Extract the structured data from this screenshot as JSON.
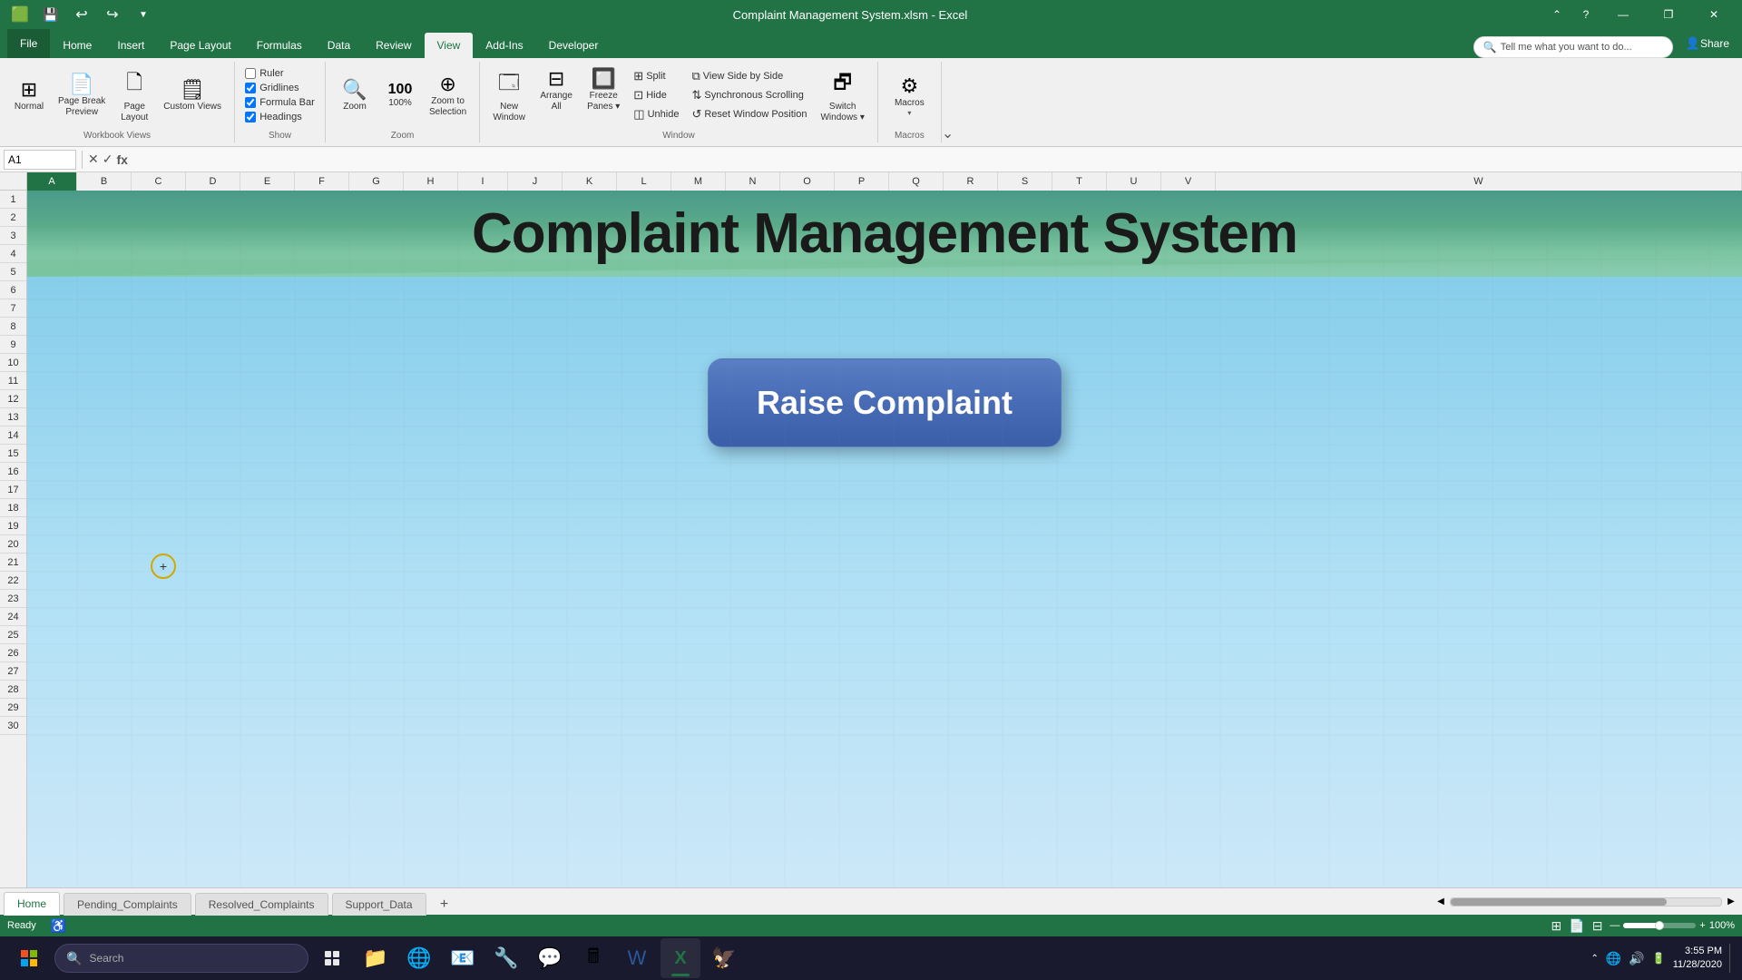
{
  "titlebar": {
    "title": "Complaint Management System.xlsm - Excel",
    "quickaccess": [
      "save",
      "undo",
      "redo",
      "customize"
    ],
    "window_controls": [
      "minimize",
      "restore",
      "close"
    ]
  },
  "ribbon": {
    "active_tab": "View",
    "tabs": [
      "File",
      "Home",
      "Insert",
      "Page Layout",
      "Formulas",
      "Data",
      "Review",
      "View",
      "Add-Ins",
      "Developer"
    ],
    "tell_me": "Tell me what you want to do...",
    "share": "Share",
    "groups": {
      "workbook_views": {
        "label": "Workbook Views",
        "normal_label": "Normal",
        "page_break_label": "Page Break\nPreview",
        "page_layout_label": "Page\nLayout",
        "custom_views_label": "Custom\nViews"
      },
      "show": {
        "label": "Show",
        "ruler_label": "Ruler",
        "gridlines_label": "Gridlines",
        "formula_bar_label": "Formula Bar",
        "headings_label": "Headings"
      },
      "zoom": {
        "label": "Zoom",
        "zoom_label": "Zoom",
        "zoom_100_label": "100%",
        "zoom_selection_label": "Zoom to\nSelection"
      },
      "window": {
        "label": "Window",
        "new_window_label": "New\nWindow",
        "arrange_all_label": "Arrange\nAll",
        "freeze_panes_label": "Freeze\nPanes",
        "split_label": "Split",
        "hide_label": "Hide",
        "unhide_label": "Unhide",
        "view_side_by_side_label": "View Side by Side",
        "synchronous_scrolling_label": "Synchronous Scrolling",
        "reset_window_label": "Reset Window Position",
        "switch_windows_label": "Switch\nWindows"
      },
      "macros": {
        "label": "Macros",
        "macros_label": "Macros"
      }
    }
  },
  "formula_bar": {
    "cell_ref": "A1",
    "formula": ""
  },
  "spreadsheet": {
    "title": "Complaint Management System",
    "raise_complaint_btn": "Raise Complaint",
    "cols": [
      "A",
      "B",
      "C",
      "D",
      "E",
      "F",
      "G",
      "H",
      "I",
      "J",
      "K",
      "L",
      "M",
      "N",
      "O",
      "P",
      "Q",
      "R",
      "S",
      "T",
      "U",
      "V",
      "W"
    ],
    "rows": [
      "1",
      "2",
      "3",
      "4",
      "5",
      "6",
      "7",
      "8",
      "9",
      "10",
      "11",
      "12",
      "13",
      "14",
      "15",
      "16",
      "17",
      "18",
      "19",
      "20",
      "21",
      "22",
      "23",
      "24",
      "25",
      "26",
      "27",
      "28",
      "29",
      "30"
    ]
  },
  "sheet_tabs": {
    "tabs": [
      "Home",
      "Pending_Complaints",
      "Resolved_Complaints",
      "Support_Data"
    ],
    "active": "Home"
  },
  "status_bar": {
    "ready": "Ready",
    "zoom": "100%",
    "zoom_out": "-",
    "zoom_in": "+"
  },
  "taskbar": {
    "search_placeholder": "Search",
    "apps": [
      "file-explorer",
      "edge",
      "outlook",
      "kutools",
      "teams",
      "calculator",
      "word",
      "excel",
      "bird-app"
    ],
    "time": "3:55 PM",
    "date": "11/28/2020",
    "system_tray": [
      "chevron",
      "network",
      "volume",
      "battery"
    ]
  }
}
